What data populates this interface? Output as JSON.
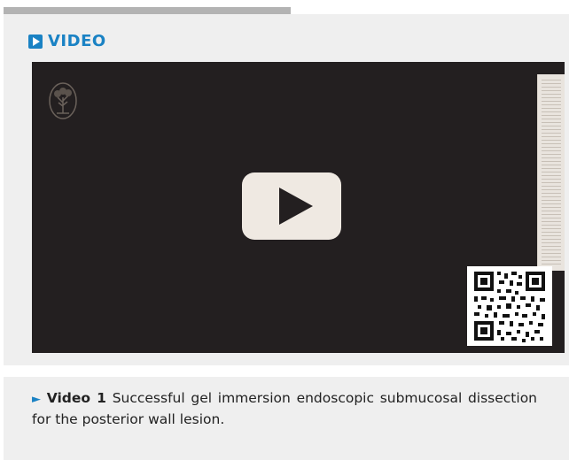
{
  "header": {
    "video_heading": "VIDEO",
    "heading_icon": "video-play-icon"
  },
  "player": {
    "logo_icon": "tree-logo-icon",
    "play_icon": "play-icon",
    "qr_icon": "qr-code-icon"
  },
  "caption": {
    "marker": "►",
    "label": "Video 1",
    "text": " Successful gel immersion endoscopic submucosal dissection for the posterior wall lesion."
  },
  "colors": {
    "accent": "#1a82c4",
    "player_bg": "#231f20",
    "panel_bg": "#efefef"
  }
}
